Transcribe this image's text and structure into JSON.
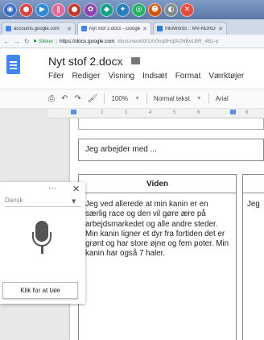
{
  "browser": {
    "tabs": [
      {
        "title": "accounts.google.com",
        "active": false
      },
      {
        "title": "Nyt stof 2.docx - Google D",
        "active": true
      },
      {
        "title": "IntoWords :: MV-NORDIC",
        "active": false
      }
    ],
    "address": {
      "secure_label": "Sikker",
      "url_host": "https://docs.google.com",
      "url_rest": "/document/d/1Xr0nq9HqfA2NBvLBR_4BJ-p"
    }
  },
  "docs": {
    "title": "Nyt stof 2.docx",
    "menu": [
      "Filer",
      "Rediger",
      "Visning",
      "Indsæt",
      "Format",
      "Værktøjer"
    ],
    "toolbar": {
      "zoom": "100%",
      "style": "Normal tekst",
      "font": "Arial"
    },
    "ruler_ticks": [
      "2",
      "3",
      "4",
      "5",
      "6",
      "8"
    ]
  },
  "document": {
    "sentence": "Jeg arbejder med ...",
    "column1": {
      "header": "Viden",
      "body": "Jeg ved allerede at min kanin er en særlig race og den vil gøre ære på arbejdsmarkedet og alle andre steder. Min kanin ligner et dyr fra fortiden det er grønt og har store øjne og fem poter. Min kanin har også 7 haler."
    },
    "column2": {
      "body": "Jeg"
    }
  },
  "voice_panel": {
    "language": "Dansk",
    "tooltip": "Klik for at tale"
  },
  "colors": {
    "docs_blue": "#4285f4",
    "secure_green": "#1e8e3e"
  }
}
